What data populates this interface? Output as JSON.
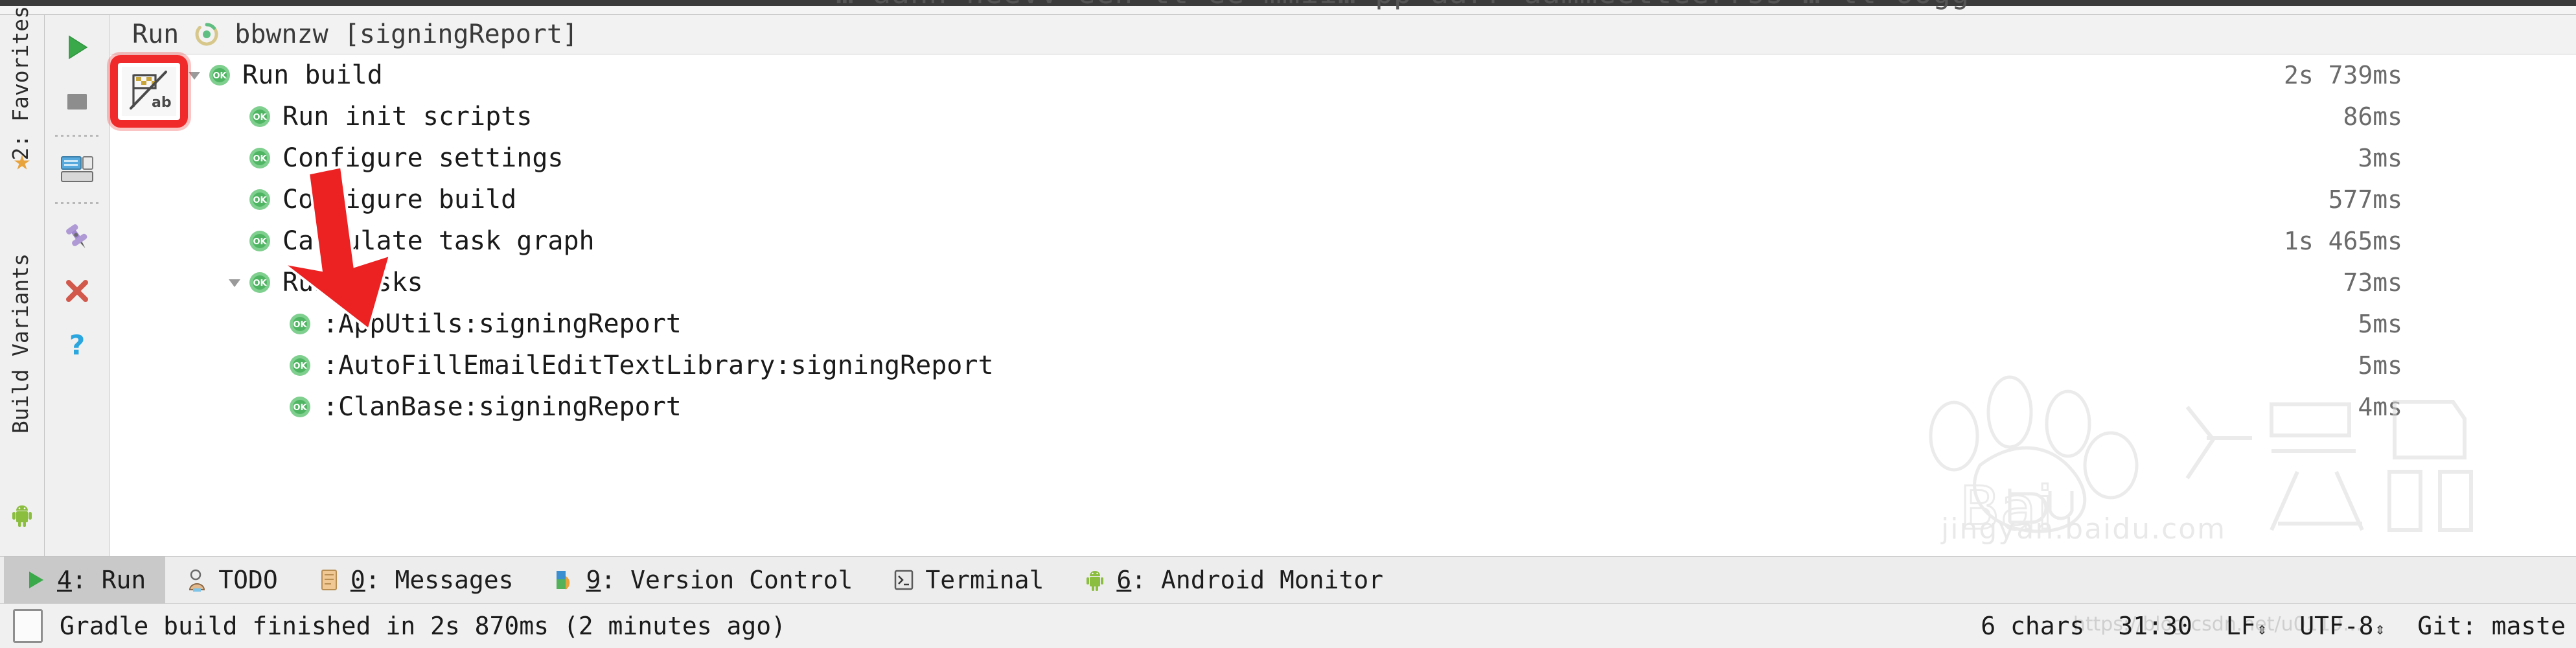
{
  "window": {
    "clipped_top_text": "… aann neevv een   tt ee mmii…   pp aarr aammeetteerrss  … ll oogg"
  },
  "left_rail": {
    "items": [
      {
        "name": "favorites",
        "label": "2: Favorites",
        "icon": "star-icon"
      },
      {
        "name": "build-variants",
        "label": "Build Variants",
        "icon": "android-icon"
      }
    ]
  },
  "tool_toolbar": {
    "buttons": [
      {
        "name": "rerun",
        "label": "Rerun",
        "icon": "play-icon"
      },
      {
        "name": "stop",
        "label": "Stop",
        "icon": "stop-icon"
      },
      {
        "name": "restore-layout",
        "label": "Restore Layout",
        "icon": "layout-icon"
      },
      {
        "name": "pin-tab",
        "label": "Pin Tab",
        "icon": "pin-icon"
      },
      {
        "name": "close",
        "label": "Close",
        "icon": "close-x-icon"
      },
      {
        "name": "help",
        "label": "Help",
        "icon": "question-icon"
      },
      {
        "name": "toggle-tasks-execution",
        "label": "Toggle tasks execution/text mode",
        "icon": "flag-ab-icon"
      }
    ],
    "highlight_color": "#f02a2a"
  },
  "tab_header": {
    "title": "Run",
    "config_icon": "gradle-icon",
    "config_name": "bbwnzw [signingReport]"
  },
  "tree": {
    "rows": [
      {
        "label": "Run build",
        "time": "2s 739ms",
        "indent": 0,
        "twisty": "down",
        "status": "ok"
      },
      {
        "label": "Run init scripts",
        "time": "86ms",
        "indent": 1,
        "twisty": "none",
        "status": "ok"
      },
      {
        "label": "Configure settings",
        "time": "3ms",
        "indent": 1,
        "twisty": "none",
        "status": "ok"
      },
      {
        "label": "Configure build",
        "time": "577ms",
        "indent": 1,
        "twisty": "none",
        "status": "ok"
      },
      {
        "label": "Calculate task graph",
        "time": "1s 465ms",
        "indent": 1,
        "twisty": "none",
        "status": "ok"
      },
      {
        "label": "Run tasks",
        "time": "73ms",
        "indent": 1,
        "twisty": "down",
        "status": "ok"
      },
      {
        "label": ":AppUtils:signingReport",
        "time": "5ms",
        "indent": 2,
        "twisty": "none",
        "status": "ok"
      },
      {
        "label": ":AutoFillEmailEditTextLibrary:signingReport",
        "time": "5ms",
        "indent": 2,
        "twisty": "none",
        "status": "ok"
      },
      {
        "label": ":ClanBase:signingReport",
        "time": "4ms",
        "indent": 2,
        "twisty": "none",
        "status": "ok"
      }
    ]
  },
  "watermark": {
    "brand": "Baidu",
    "suffix": "经验",
    "url": "jingyan.baidu.com"
  },
  "bottom_tabs": [
    {
      "name": "run",
      "num": "4",
      "label": "Run",
      "icon": "play-icon",
      "active": true
    },
    {
      "name": "todo",
      "num": "",
      "label": "TODO",
      "icon": "todo-icon",
      "active": false
    },
    {
      "name": "messages",
      "num": "0",
      "label": "Messages",
      "icon": "messages-icon",
      "active": false
    },
    {
      "name": "version-control",
      "num": "9",
      "label": "Version Control",
      "icon": "vcs-icon",
      "active": false
    },
    {
      "name": "terminal",
      "num": "",
      "label": "Terminal",
      "icon": "terminal-icon",
      "active": false
    },
    {
      "name": "android-monitor",
      "num": "6",
      "label": "Android Monitor",
      "icon": "android-icon",
      "active": false
    }
  ],
  "status_bar": {
    "message": "Gradle build finished in 2s 870ms (2 minutes ago)",
    "chars": "6 chars",
    "caret": "31:30",
    "line_separator": "LF",
    "encoding": "UTF-8",
    "branch": "Git: maste",
    "faint_url": "https://blog.csdn.net/u0119…"
  }
}
